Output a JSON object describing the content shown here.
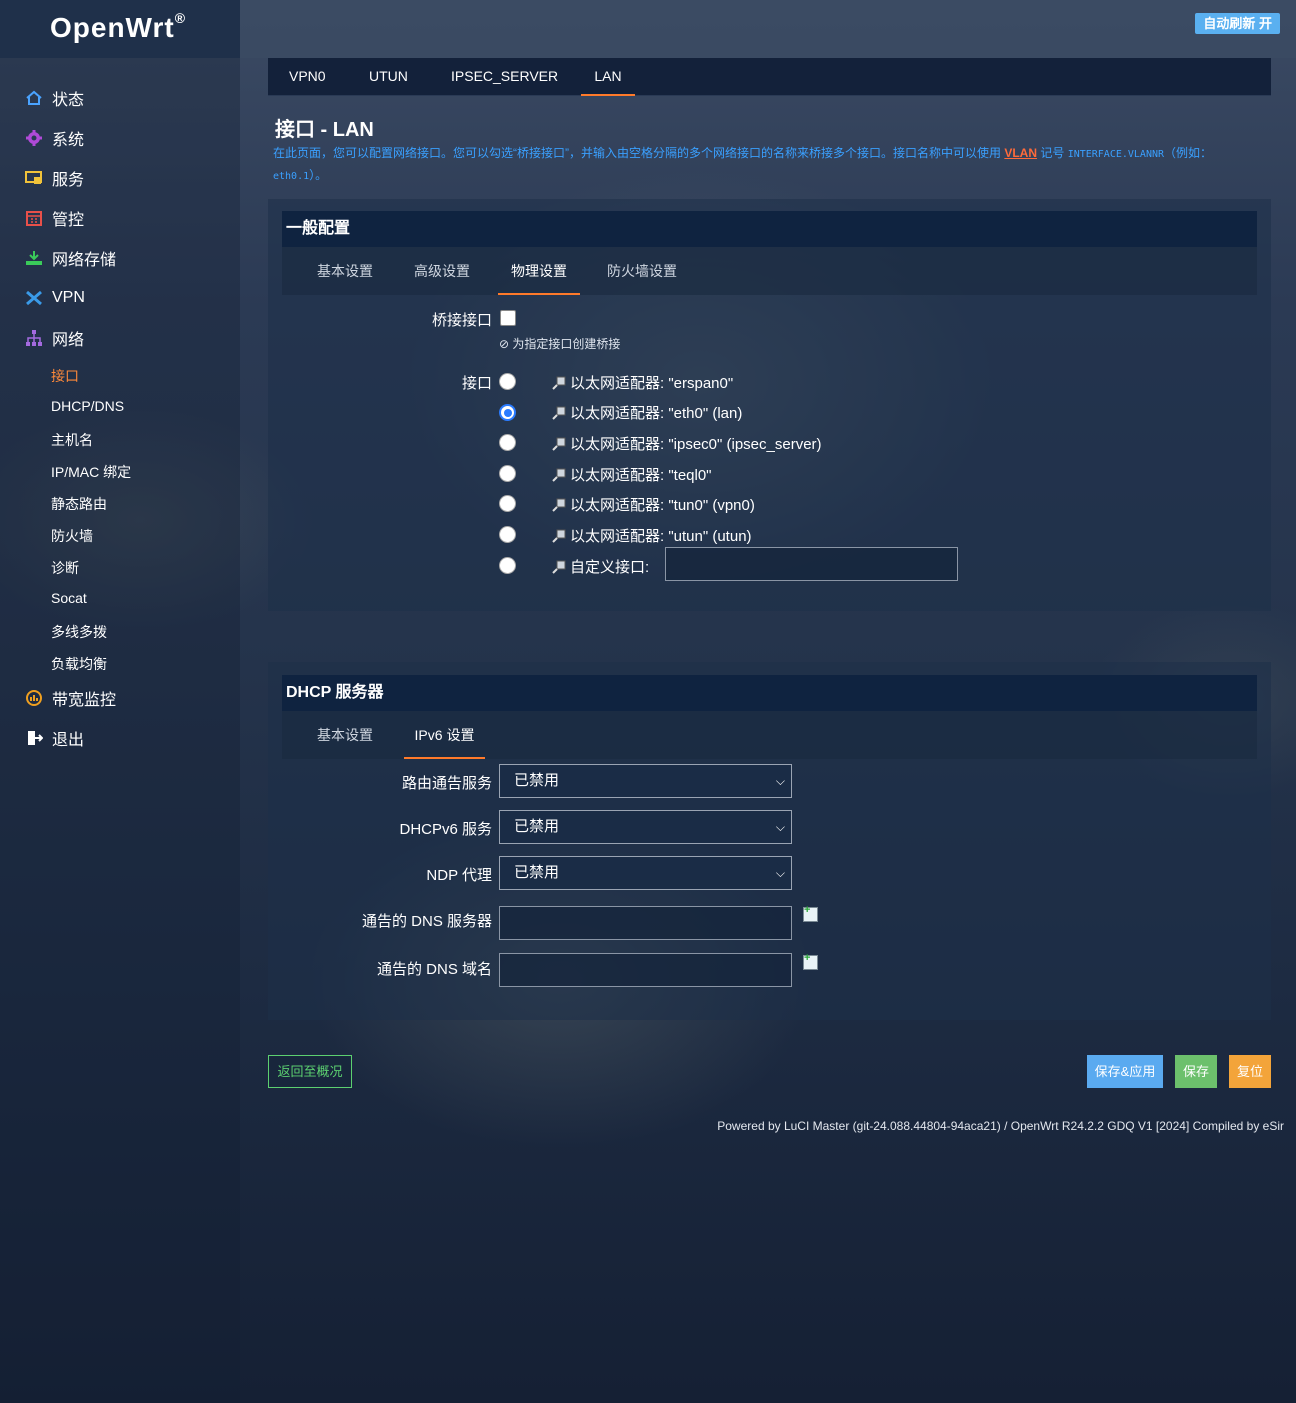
{
  "header": {
    "brand": "OpenWrt",
    "brand_mark": "®",
    "auto_refresh": "自动刷新 开"
  },
  "sidebar": {
    "items": [
      {
        "label": "状态",
        "icon": "home-icon",
        "color": "#4aa3ff"
      },
      {
        "label": "系统",
        "icon": "gear-icon",
        "color": "#b04ad8"
      },
      {
        "label": "服务",
        "icon": "services-icon",
        "color": "#f0c23a"
      },
      {
        "label": "管控",
        "icon": "control-icon",
        "color": "#e8504a"
      },
      {
        "label": "网络存储",
        "icon": "storage-icon",
        "color": "#3acb5a"
      },
      {
        "label": "VPN",
        "icon": "vpn-icon",
        "color": "#3a9ae8"
      },
      {
        "label": "网络",
        "icon": "network-icon",
        "color": "#a46ae0"
      },
      {
        "label": "带宽监控",
        "icon": "bandwidth-icon",
        "color": "#f0a020"
      },
      {
        "label": "退出",
        "icon": "logout-icon",
        "color": "#ffffff"
      }
    ],
    "sub_items": [
      "接口",
      "DHCP/DNS",
      "主机名",
      "IP/MAC 绑定",
      "静态路由",
      "防火墙",
      "诊断",
      "Socat",
      "多线多拨",
      "负载均衡"
    ]
  },
  "top_tabs": [
    "VPN0",
    "UTUN",
    "IPSEC_SERVER",
    "LAN"
  ],
  "page": {
    "title": "接口 - LAN",
    "desc_before": "在此页面，您可以配置网络接口。您可以勾选“桥接接口”，并输入由空格分隔的多个网络接口的名称来桥接多个接口。接口名称中可以使用 ",
    "desc_vlan": "VLAN",
    "desc_mid": " 记号 ",
    "desc_code1": "INTERFACE.VLANNR",
    "desc_paren": "（例如：",
    "desc_code2": "eth0.1",
    "desc_end": "）。"
  },
  "general": {
    "title": "一般配置",
    "tabs": [
      "基本设置",
      "高级设置",
      "物理设置",
      "防火墙设置"
    ],
    "bridge_label": "桥接接口",
    "bridge_hint": "为指定接口创建桥接",
    "iface_label": "接口",
    "interfaces": [
      "以太网适配器: \"erspan0\"",
      "以太网适配器: \"eth0\" (lan)",
      "以太网适配器: \"ipsec0\" (ipsec_server)",
      "以太网适配器: \"teql0\"",
      "以太网适配器: \"tun0\" (vpn0)",
      "以太网适配器: \"utun\" (utun)",
      "自定义接口:"
    ],
    "custom_value": ""
  },
  "dhcp": {
    "title": "DHCP 服务器",
    "tabs": [
      "基本设置",
      "IPv6 设置"
    ],
    "ra_label": "路由通告服务",
    "ra_value": "已禁用",
    "dhcpv6_label": "DHCPv6 服务",
    "dhcpv6_value": "已禁用",
    "ndp_label": "NDP 代理",
    "ndp_value": "已禁用",
    "dns_server_label": "通告的 DNS 服务器",
    "dns_server_value": "",
    "dns_domain_label": "通告的 DNS 域名",
    "dns_domain_value": ""
  },
  "actions": {
    "back": "返回至概况",
    "apply": "保存&应用",
    "save": "保存",
    "reset": "复位"
  },
  "footer": "Powered by LuCI Master (git-24.088.44804-94aca21) / OpenWrt R24.2.2 GDQ V1 [2024] Compiled by eSir"
}
